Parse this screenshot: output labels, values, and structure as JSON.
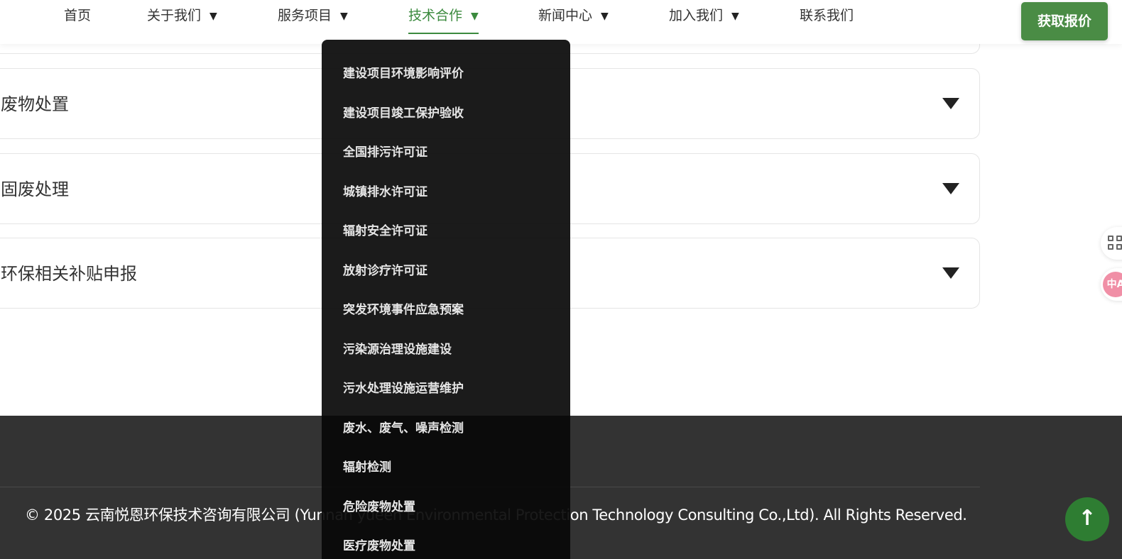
{
  "nav": {
    "items": [
      {
        "label": "首页",
        "has_caret": false
      },
      {
        "label": "关于我们",
        "has_caret": true
      },
      {
        "label": "服务项目",
        "has_caret": true
      },
      {
        "label": "技术合作",
        "has_caret": true,
        "active": true
      },
      {
        "label": "新闻中心",
        "has_caret": true
      },
      {
        "label": "加入我们",
        "has_caret": true
      },
      {
        "label": "联系我们",
        "has_caret": false
      }
    ],
    "caret": "▼",
    "quote_button": "获取报价"
  },
  "accordion": {
    "items": [
      {
        "title": "废物处置"
      },
      {
        "title": "固废处理"
      },
      {
        "title": "环保相关补贴申报"
      }
    ]
  },
  "dropdown": {
    "items": [
      "建设项目环境影响评价",
      "建设项目竣工保护验收",
      "全国排污许可证",
      "城镇排水许可证",
      "辐射安全许可证",
      "放射诊疗许可证",
      "突发环境事件应急预案",
      "污染源治理设施建设",
      "污水处理设施运营维护",
      "废水、废气、噪声检测",
      "辐射检测",
      "危险废物处置",
      "医疗废物处置"
    ]
  },
  "floating_tools": {
    "apps_icon": "apps-icon",
    "translate_icon": "translate-icon",
    "translate_badge": "中A"
  },
  "footer": {
    "copyright": "© 2025 云南悦恩环保技术咨询有限公司 (Yunnan yueen Environmental Protection Technology Consulting Co.,Ltd). All Rights Reserved.",
    "back_to_top": "↑"
  },
  "colors": {
    "accent_green": "#3b8a3e",
    "button_green": "#4a8c45",
    "footer_bg": "#333333",
    "dropdown_bg": "#080808"
  }
}
